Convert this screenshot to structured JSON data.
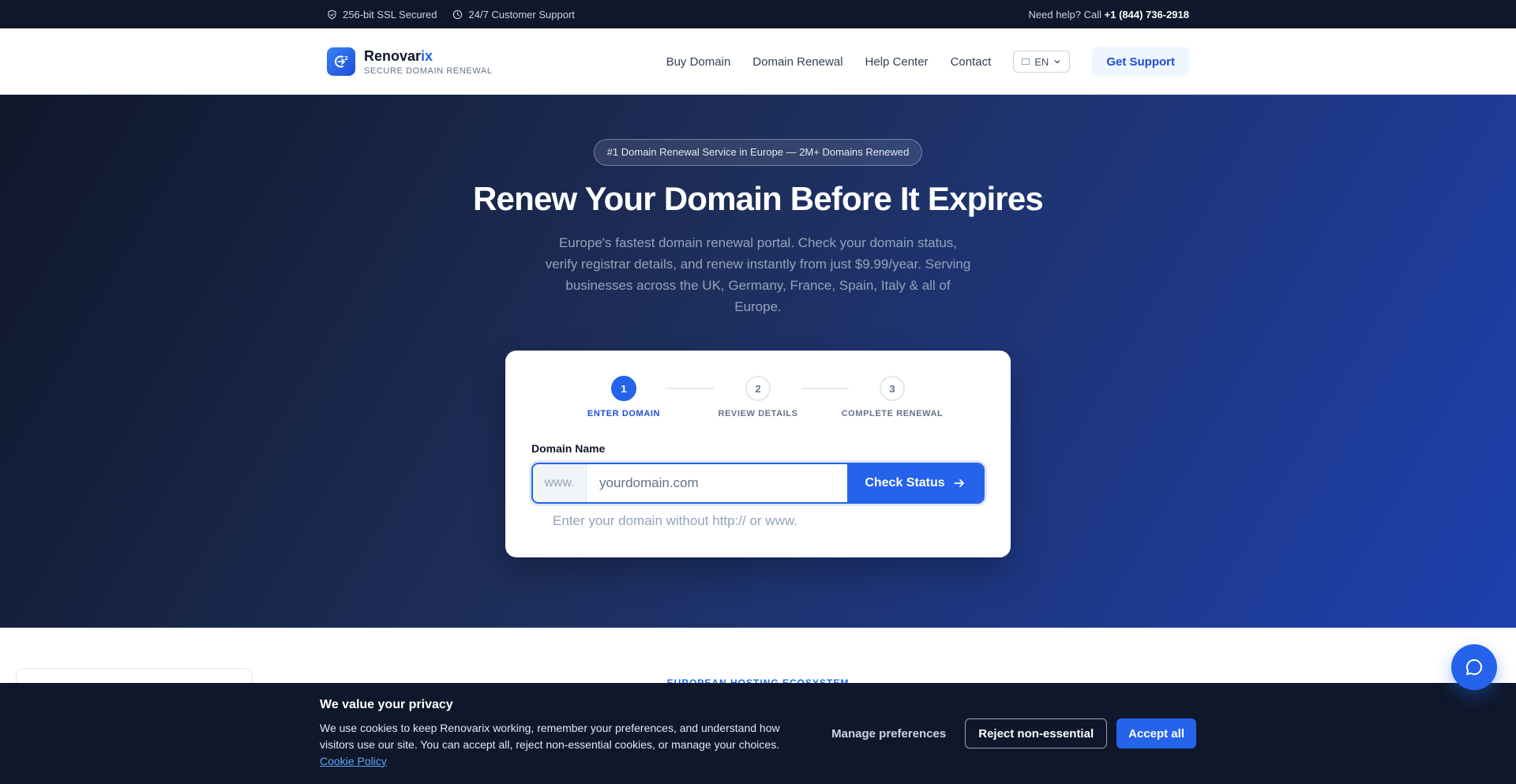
{
  "topbar": {
    "ssl": "256-bit SSL Secured",
    "support": "24/7 Customer Support",
    "help_prefix": "Need help? Call",
    "phone": "+1 (844) 736-2918"
  },
  "brand": {
    "name_main": "Renovar",
    "name_accent": "ix",
    "tagline": "SECURE DOMAIN RENEWAL"
  },
  "nav": {
    "items": [
      "Buy Domain",
      "Domain Renewal",
      "Help Center",
      "Contact"
    ],
    "language": "EN",
    "support_button": "Get Support"
  },
  "hero": {
    "badge": "#1 Domain Renewal Service in Europe — 2M+ Domains Renewed",
    "title": "Renew Your Domain Before It Expires",
    "subtitle": "Europe's fastest domain renewal portal. Check your domain status, verify registrar details, and renew instantly from just $9.99/year. Serving businesses across the UK, Germany, France, Spain, Italy & all of Europe."
  },
  "form": {
    "steps": [
      {
        "number": "1",
        "label": "ENTER DOMAIN",
        "active": true
      },
      {
        "number": "2",
        "label": "REVIEW DETAILS",
        "active": false
      },
      {
        "number": "3",
        "label": "COMPLETE RENEWAL",
        "active": false
      }
    ],
    "field_label": "Domain Name",
    "prefix": "www.",
    "placeholder": "yourdomain.com",
    "value": "",
    "button": "Check Status",
    "hint": "Enter your domain without http:// or www."
  },
  "below": {
    "eyebrow": "EUROPEAN HOSTING ECOSYSTEM"
  },
  "cookie": {
    "title": "We value your privacy",
    "body": "We use cookies to keep Renovarix working, remember your preferences, and understand how visitors use our site. You can accept all, reject non-essential cookies, or manage your choices.",
    "policy_link": "Cookie Policy",
    "manage": "Manage preferences",
    "reject": "Reject non-essential",
    "accept": "Accept all"
  },
  "colors": {
    "accent": "#2563eb",
    "dark": "#0f172a"
  },
  "icons": [
    "shield-check-icon",
    "clock-icon",
    "logo-icon",
    "chevron-down-icon",
    "arrow-right-icon",
    "chat-bubble-icon"
  ]
}
